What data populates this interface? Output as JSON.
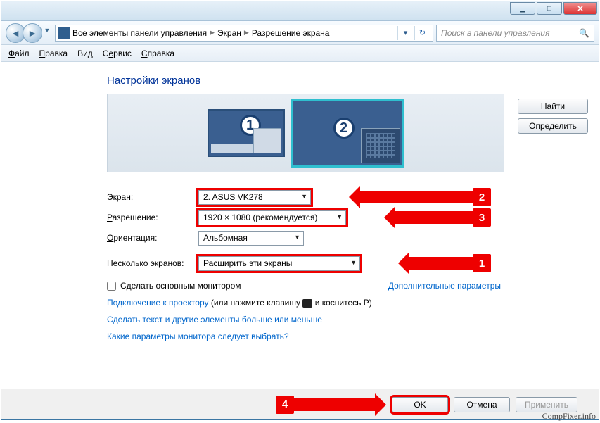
{
  "window": {
    "min": "min",
    "max": "max",
    "close": "close"
  },
  "breadcrumbs": {
    "root": "Все элементы панели управления",
    "b1": "Экран",
    "b2": "Разрешение экрана"
  },
  "search": {
    "placeholder": "Поиск в панели управления"
  },
  "menu": {
    "file": "Файл",
    "edit": "Правка",
    "view": "Вид",
    "tools": "Сервис",
    "help": "Справка"
  },
  "heading": "Настройки экранов",
  "sidebuttons": {
    "find": "Найти",
    "identify": "Определить"
  },
  "monitors": {
    "m1": "1",
    "m2": "2"
  },
  "labels": {
    "screen": "Экран:",
    "resolution": "Разрешение:",
    "orientation": "Ориентация:",
    "multi": "Несколько экранов:"
  },
  "values": {
    "screen": "2. ASUS VK278",
    "resolution": "1920 × 1080 (рекомендуется)",
    "orientation": "Альбомная",
    "multi": "Расширить эти экраны"
  },
  "checkbox": "Сделать основным монитором",
  "links": {
    "advanced": "Дополнительные параметры",
    "projector_a": "Подключение к проектору",
    "projector_b": " (или нажмите клавишу ",
    "projector_c": " и коснитесь P)",
    "textsize": "Сделать текст и другие элементы больше или меньше",
    "which": "Какие параметры монитора следует выбрать?"
  },
  "footer": {
    "ok": "OK",
    "cancel": "Отмена",
    "apply": "Применить"
  },
  "annotations": {
    "n1": "1",
    "n2": "2",
    "n3": "3",
    "n4": "4"
  },
  "watermark": "CompFixer.info"
}
